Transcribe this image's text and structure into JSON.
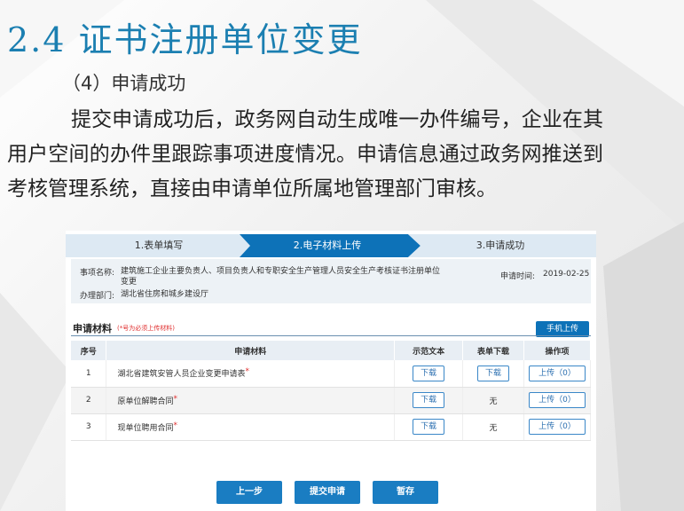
{
  "slide": {
    "title": "2.4 证书注册单位变更",
    "subtitle": "（4）申请成功",
    "paragraph": "提交申请成功后，政务网自动生成唯一办件编号，企业在其用户空间的办件里跟踪事项进度情况。申请信息通过政务网推送到考核管理系统，直接由申请单位所属地管理部门审核。"
  },
  "colors": {
    "accent": "#1b7fb1",
    "primary": "#0d72b8",
    "step_inactive": "#dde9f3",
    "required": "#e03030"
  },
  "steps": [
    {
      "label": "1.表单填写",
      "active": false
    },
    {
      "label": "2.电子材料上传",
      "active": true
    },
    {
      "label": "3.申请成功",
      "active": false
    }
  ],
  "info": {
    "item_label": "事项名称:",
    "item_value": "建筑施工企业主要负责人、项目负责人和专职安全生产管理人员安全生产考核证书注册单位变更",
    "dept_label": "办理部门:",
    "dept_value": "湖北省住房和城乡建设厅",
    "time_label": "申请时间:",
    "time_value": "2019-02-25"
  },
  "materials": {
    "title": "申请材料",
    "note": "(*号为必须上传材料)",
    "mobile_upload": "手机上传",
    "columns": [
      "序号",
      "申请材料",
      "示范文本",
      "表单下载",
      "操作项"
    ],
    "rows": [
      {
        "no": "1",
        "name": "湖北省建筑安管人员企业变更申请表",
        "sample": "下载",
        "form": "下载",
        "op": "上传（0）"
      },
      {
        "no": "2",
        "name": "原单位解聘合同",
        "sample": "下载",
        "form": "无",
        "op": "上传（0）"
      },
      {
        "no": "3",
        "name": "现单位聘用合同",
        "sample": "下载",
        "form": "无",
        "op": "上传（0）"
      }
    ],
    "required_mark": "*"
  },
  "buttons": {
    "prev": "上一步",
    "submit": "提交申请",
    "save": "暂存"
  }
}
